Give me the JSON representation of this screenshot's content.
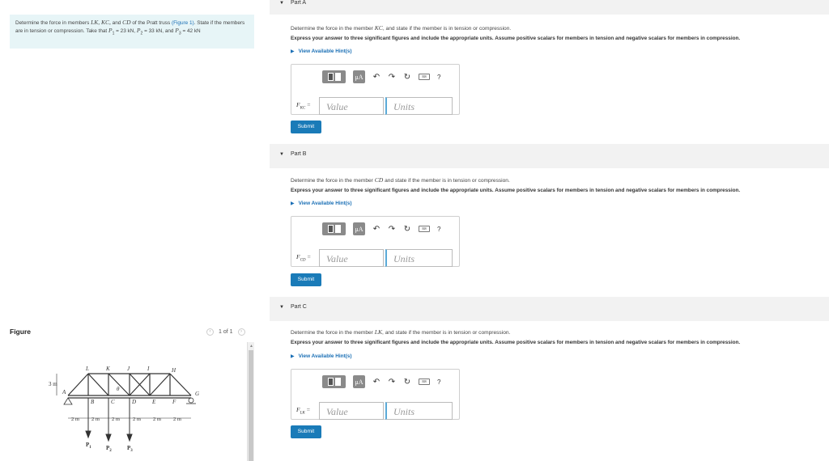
{
  "problem": {
    "intro": "Determine the force in members",
    "members_list": "LK, KC,",
    "and_word": "and",
    "member_cd": "CD",
    "mid": "of the Pratt truss",
    "figure_link": "(Figure 1)",
    "state": ". State if the members are in tension or compression. Take that",
    "p1": "P",
    "p1_val": "= 23 kN,",
    "p2_val": "= 33 kN,",
    "and2": "and",
    "p3_val": "= 42 kN"
  },
  "figure": {
    "title": "Figure",
    "pager": "1 of 1",
    "prev_icon": "chevron-left-icon",
    "next_icon": "chevron-right-icon",
    "labels": {
      "top": [
        "L",
        "K",
        "J",
        "I",
        "H"
      ],
      "bottom": [
        "A",
        "B",
        "C",
        "D",
        "E",
        "F",
        "G"
      ],
      "height": "3 m",
      "angle": "θ",
      "spans": [
        "2 m",
        "2 m",
        "2 m",
        "2 m",
        "2 m",
        "2 m"
      ],
      "loads": [
        "P",
        "P",
        "P"
      ],
      "load_subs": [
        "1",
        "2",
        "3"
      ]
    }
  },
  "parts": [
    {
      "title": "Part A",
      "q_pre": "Determine the force in the member",
      "member": "KC",
      "q_post": ", and state if the member is in tension or compression.",
      "instructions": "Express your answer to three significant figures and include the appropriate units. Assume positive scalars for members in tension and negative scalars for members in compression.",
      "hint": "View Available Hint(s)",
      "field_label": "F",
      "field_sub": "KC",
      "value_placeholder": "Value",
      "units_placeholder": "Units",
      "submit": "Submit"
    },
    {
      "title": "Part B",
      "q_pre": "Determine the force in the member",
      "member": "CD",
      "q_post": " and state if the member is in tension or compression.",
      "instructions": "Express your answer to three significant figures and include the appropriate units. Assume positive scalars for members in tension and negative scalars for members in compression.",
      "hint": "View Available Hint(s)",
      "field_label": "F",
      "field_sub": "CD",
      "value_placeholder": "Value",
      "units_placeholder": "Units",
      "submit": "Submit"
    },
    {
      "title": "Part C",
      "q_pre": "Determine the force in the member",
      "member": "LK",
      "q_post": ", and state if the member is in tension or compression.",
      "instructions": "Express your answer to three significant figures and include the appropriate units. Assume positive scalars for members in tension and negative scalars for members in compression.",
      "hint": "View Available Hint(s)",
      "field_label": "F",
      "field_sub": "LK",
      "value_placeholder": "Value",
      "units_placeholder": "Units",
      "submit": "Submit"
    }
  ],
  "toolbar": {
    "mu": "μA",
    "undo_icon": "undo-icon",
    "redo_icon": "redo-icon",
    "reset_icon": "reset-icon",
    "keyboard_icon": "keyboard-icon",
    "help": "?"
  },
  "colors": {
    "accent": "#1a7bb8",
    "problem_bg": "#e7f5f7",
    "link": "#1a6fb5"
  }
}
